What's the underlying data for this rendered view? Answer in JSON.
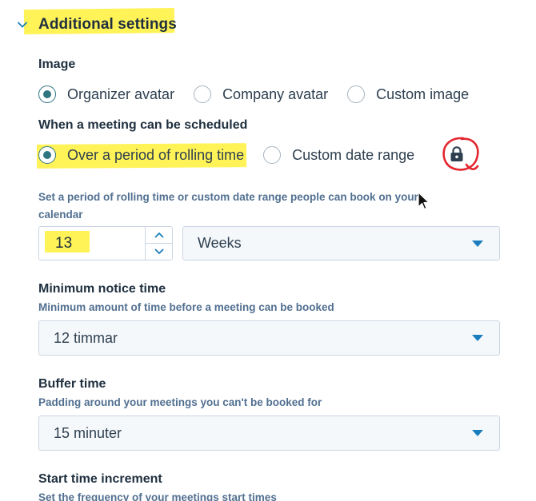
{
  "section": {
    "title": "Additional settings",
    "expanded_icon": "chevron-down-icon"
  },
  "image": {
    "label": "Image",
    "options": [
      {
        "label": "Organizer avatar",
        "selected": true
      },
      {
        "label": "Company avatar",
        "selected": false
      },
      {
        "label": "Custom image",
        "selected": false
      }
    ]
  },
  "schedule": {
    "label": "When a meeting can be scheduled",
    "options": [
      {
        "label": "Over a period of rolling time",
        "selected": true
      },
      {
        "label": "Custom date range",
        "selected": false,
        "icon": "lock-icon"
      }
    ]
  },
  "rolling": {
    "help": "Set a period of rolling time or custom date range people can book on your calendar",
    "value": "13",
    "unit": "Weeks"
  },
  "min_notice": {
    "label": "Minimum notice time",
    "help": "Minimum amount of time before a meeting can be booked",
    "value": "12 timmar"
  },
  "buffer": {
    "label": "Buffer time",
    "help": "Padding around your meetings you can't be booked for",
    "value": "15 minuter"
  },
  "start_increment": {
    "label": "Start time increment",
    "help": "Set the frequency of your meetings start times"
  },
  "colors": {
    "highlight": "#fff24a",
    "annotation": "#e3262f",
    "radio_checked": "#2f7580",
    "caret": "#1a7ebe"
  }
}
